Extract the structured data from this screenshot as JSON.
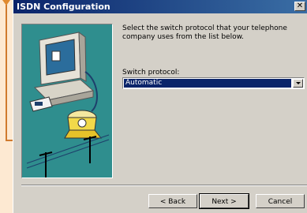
{
  "window": {
    "title": "ISDN Configuration",
    "close_glyph": "✕"
  },
  "content": {
    "instruction": "Select the switch protocol that your telephone company uses from the list below.",
    "switch_label": "Switch protocol:",
    "switch_value": "Automatic"
  },
  "buttons": {
    "back": "< Back",
    "next": "Next >",
    "cancel": "Cancel"
  },
  "colors": {
    "titlebar_start": "#0a246a",
    "titlebar_end": "#3a6ea5",
    "illustration_bg": "#2f8e8e",
    "annotation": "#e08a30",
    "page_bg": "#fde9d2"
  }
}
